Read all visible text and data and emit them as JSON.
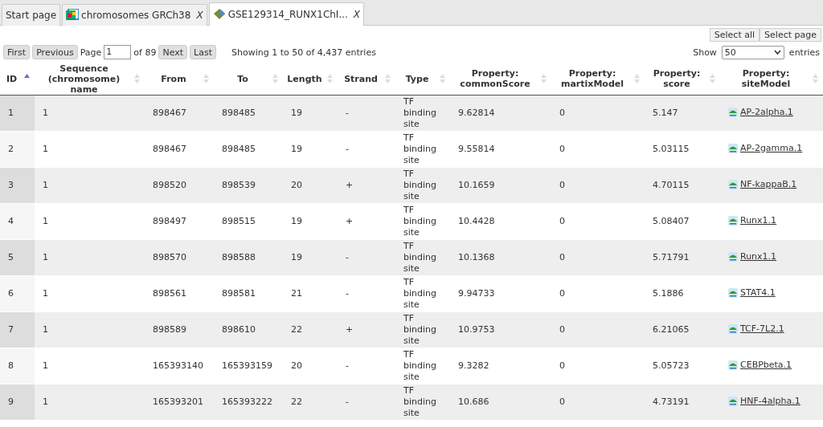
{
  "tabs": [
    {
      "label": "Start page",
      "kind": "plain",
      "selected": false
    },
    {
      "label": "chromosomes GRCh38",
      "kind": "genome",
      "close": "X",
      "selected": false
    },
    {
      "label": "GSE129314_RUNX1ChI...",
      "kind": "track",
      "close": "X",
      "selected": true
    }
  ],
  "selection_buttons": [
    "Select all",
    "Select page"
  ],
  "pager": {
    "first": "First",
    "previous": "Previous",
    "page_label": "Page",
    "page_value": "1",
    "of_label": "of 89",
    "next": "Next",
    "last": "Last",
    "info": "Showing 1 to 50 of 4,437 entries"
  },
  "length_menu": {
    "show_label": "Show",
    "value": "50",
    "entries_label": "entries"
  },
  "table": {
    "columns": [
      {
        "label": "ID",
        "sorted": true
      },
      {
        "label": "Sequence (chromosome) name",
        "sorted": false
      },
      {
        "label": "From",
        "sorted": false
      },
      {
        "label": "To",
        "sorted": false
      },
      {
        "label": "Length",
        "sorted": false
      },
      {
        "label": "Strand",
        "sorted": false
      },
      {
        "label": "Type",
        "sorted": false
      },
      {
        "label": "Property: commonScore",
        "sorted": false
      },
      {
        "label": "Property: martixModel",
        "sorted": false
      },
      {
        "label": "Property: score",
        "sorted": false
      },
      {
        "label": "Property: siteModel",
        "sorted": false
      }
    ],
    "rows": [
      [
        "1",
        "1",
        "898467",
        "898485",
        "19",
        "-",
        "TF binding site",
        "9.62814",
        "0",
        "5.147",
        "AP-2alpha.1"
      ],
      [
        "2",
        "1",
        "898467",
        "898485",
        "19",
        "-",
        "TF binding site",
        "9.55814",
        "0",
        "5.03115",
        "AP-2gamma.1"
      ],
      [
        "3",
        "1",
        "898520",
        "898539",
        "20",
        "+",
        "TF binding site",
        "10.1659",
        "0",
        "4.70115",
        "NF-kappaB.1"
      ],
      [
        "4",
        "1",
        "898497",
        "898515",
        "19",
        "+",
        "TF binding site",
        "10.4428",
        "0",
        "5.08407",
        "Runx1.1"
      ],
      [
        "5",
        "1",
        "898570",
        "898588",
        "19",
        "-",
        "TF binding site",
        "10.1368",
        "0",
        "5.71791",
        "Runx1.1"
      ],
      [
        "6",
        "1",
        "898561",
        "898581",
        "21",
        "-",
        "TF binding site",
        "9.94733",
        "0",
        "5.1886",
        "STAT4.1"
      ],
      [
        "7",
        "1",
        "898589",
        "898610",
        "22",
        "+",
        "TF binding site",
        "10.9753",
        "0",
        "6.21065",
        "TCF-7L2.1"
      ],
      [
        "8",
        "1",
        "165393140",
        "165393159",
        "20",
        "-",
        "TF binding site",
        "9.3282",
        "0",
        "5.05723",
        "CEBPbeta.1"
      ],
      [
        "9",
        "1",
        "165393201",
        "165393222",
        "22",
        "-",
        "TF binding site",
        "10.686",
        "0",
        "4.73191",
        "HNF-4alpha.1"
      ]
    ]
  }
}
